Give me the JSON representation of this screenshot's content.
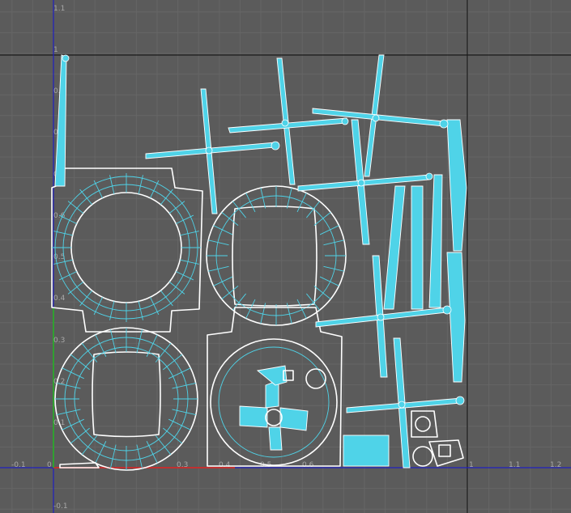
{
  "editor": {
    "background": "#5b5b5b",
    "grid_color": "#666666",
    "shell_color": "#ffffff",
    "edge_color": "#4fd3e8",
    "u_axis_color": "#c03030",
    "v_axis_color": "#30a030",
    "origin_axis_color": "#2020c0",
    "boundary_color": "#111111"
  },
  "ticks": {
    "u": [
      "-0.1",
      "0.3",
      "0.4",
      "0.5",
      "0.6",
      "1",
      "1.1",
      "1.2"
    ],
    "v": [
      "1.1",
      "1",
      "0.9",
      "0.8",
      "0.7",
      "0.6",
      "0.5",
      "0.4",
      "0.3",
      "0.2",
      "0.1",
      "-0.1"
    ]
  },
  "origin_label": "0"
}
